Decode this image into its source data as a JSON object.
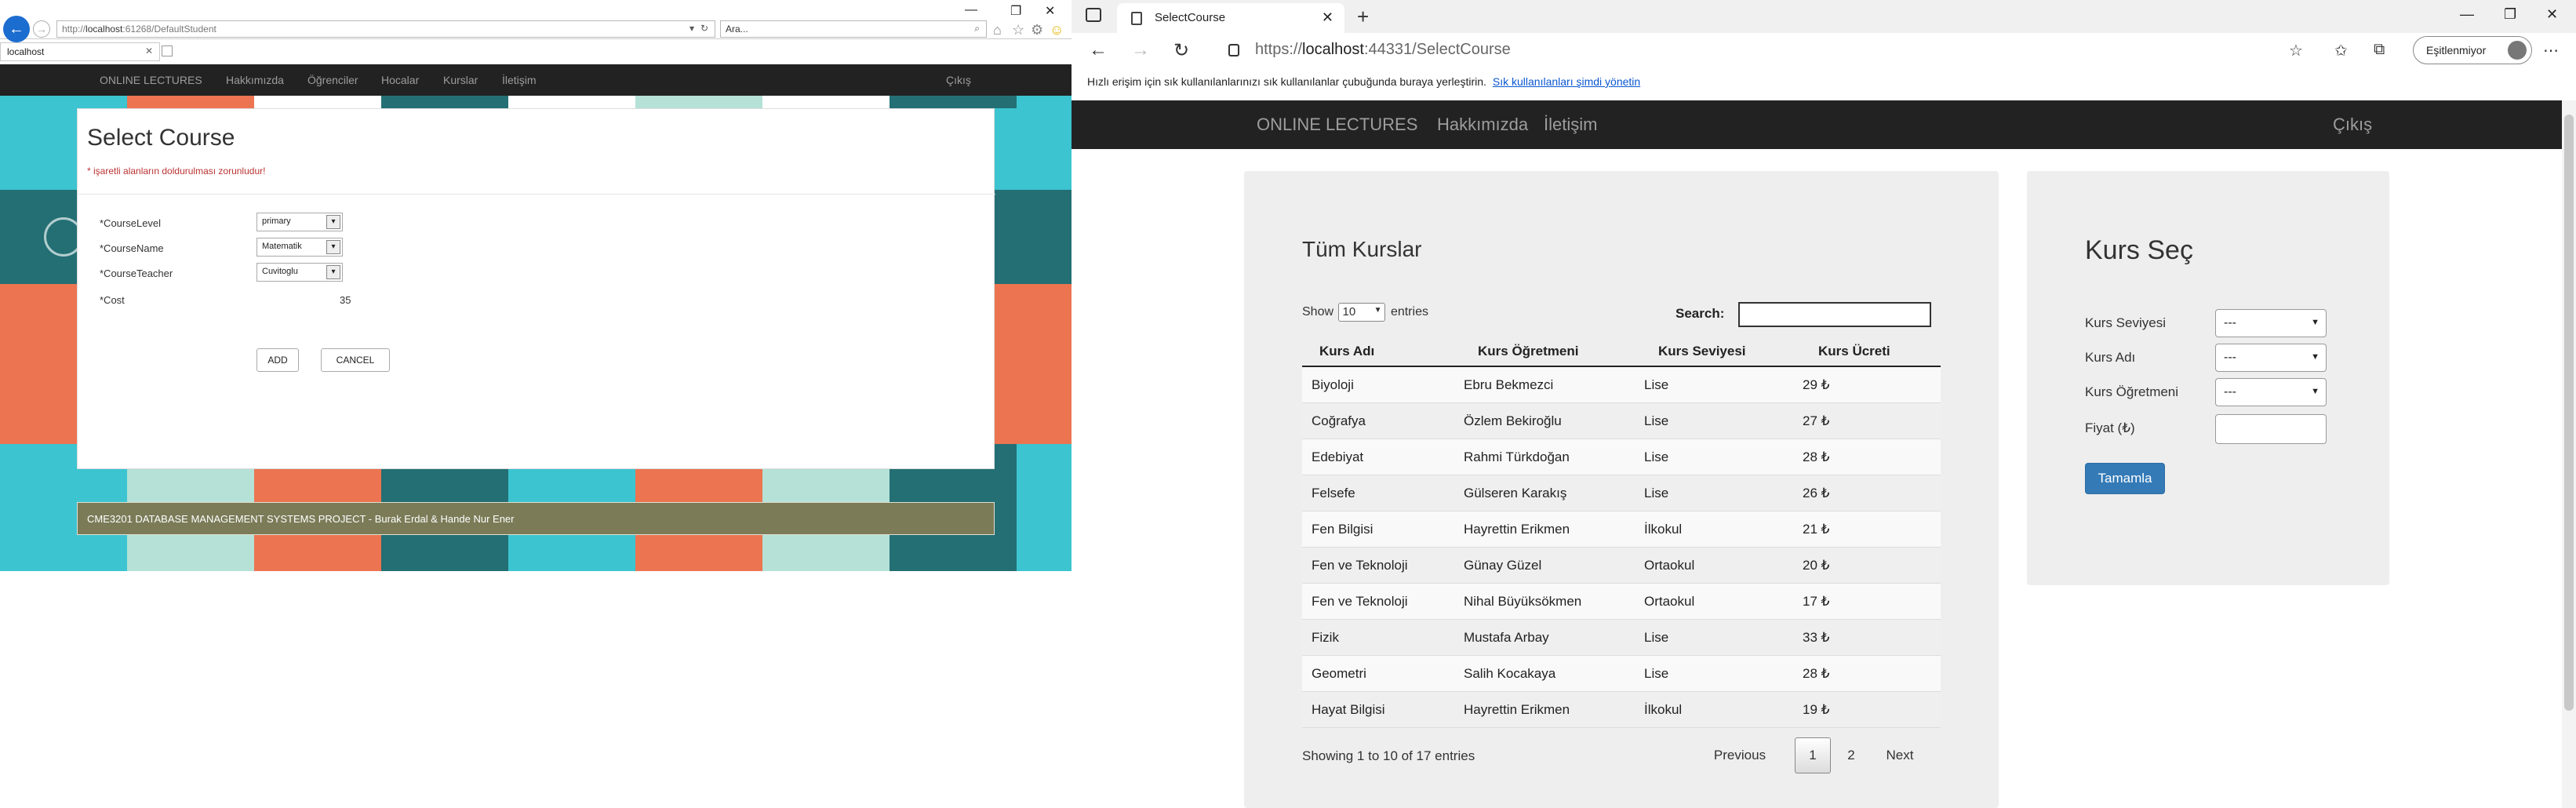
{
  "left_window": {
    "address": {
      "prefix": "http://",
      "host": "localhost",
      "rest": ":61268/DefaultStudent"
    },
    "search_placeholder": "Ara...",
    "tab_title": "localhost",
    "nav": {
      "items": [
        "ONLINE LECTURES",
        "Hakkımızda",
        "Öğrenciler",
        "Hocalar",
        "Kurslar",
        "İletişim"
      ],
      "logout": "Çıkış"
    },
    "form": {
      "title": "Select Course",
      "required_note": "* işaretli alanların doldurulması zorunludur!",
      "fields": [
        {
          "label": "*CourseLevel",
          "value": "primary"
        },
        {
          "label": "*CourseName",
          "value": "Matematik"
        },
        {
          "label": "*CourseTeacher",
          "value": "Cuvitoglu"
        }
      ],
      "cost_label": "*Cost",
      "cost_value": "35",
      "add_label": "ADD",
      "cancel_label": "CANCEL"
    },
    "footer": "CME3201 DATABASE MANAGEMENT SYSTEMS PROJECT - Burak Erdal & Hande Nur Ener"
  },
  "right_window": {
    "tab_title": "SelectCourse",
    "url": {
      "prefix": "https://",
      "host": "localhost",
      "rest": ":44331/SelectCourse"
    },
    "sync_label": "Eşitlenmiyor",
    "favorites_bar": {
      "text": "Hızlı erişim için sık kullanılanlarınızı sık kullanılanlar çubuğunda buraya yerleştirin.",
      "link": "Sık kullanılanları şimdi yönetin"
    },
    "nav": {
      "brand": "ONLINE LECTURES",
      "items": [
        "Hakkımızda",
        "İletişim"
      ],
      "logout": "Çıkış"
    },
    "all_courses": {
      "title": "Tüm Kurslar",
      "show": "Show",
      "entries_value": "10",
      "entries": "entries",
      "search_label": "Search:",
      "headers": [
        "Kurs Adı",
        "Kurs Öğretmeni",
        "Kurs Seviyesi",
        "Kurs Ücreti"
      ],
      "rows": [
        [
          "Biyoloji",
          "Ebru Bekmezci",
          "Lise",
          "29 ₺"
        ],
        [
          "Coğrafya",
          "Özlem Bekiroğlu",
          "Lise",
          "27 ₺"
        ],
        [
          "Edebiyat",
          "Rahmi Türkdoğan",
          "Lise",
          "28 ₺"
        ],
        [
          "Felsefe",
          "Gülseren Karakış",
          "Lise",
          "26 ₺"
        ],
        [
          "Fen Bilgisi",
          "Hayrettin Erikmen",
          "İlkokul",
          "21 ₺"
        ],
        [
          "Fen ve Teknoloji",
          "Günay Güzel",
          "Ortaokul",
          "20 ₺"
        ],
        [
          "Fen ve Teknoloji",
          "Nihal Büyüksökmen",
          "Ortaokul",
          "17 ₺"
        ],
        [
          "Fizik",
          "Mustafa Arbay",
          "Lise",
          "33 ₺"
        ],
        [
          "Geometri",
          "Salih Kocakaya",
          "Lise",
          "28 ₺"
        ],
        [
          "Hayat Bilgisi",
          "Hayrettin Erikmen",
          "İlkokul",
          "19 ₺"
        ]
      ],
      "info": "Showing 1 to 10 of 17 entries",
      "pagination": {
        "previous": "Previous",
        "page1": "1",
        "page2": "2",
        "next": "Next"
      }
    },
    "select_course": {
      "title": "Kurs Seç",
      "fields": [
        {
          "label": "Kurs Seviyesi",
          "value": "---"
        },
        {
          "label": "Kurs Adı",
          "value": "---"
        },
        {
          "label": "Kurs Öğretmeni",
          "value": "---"
        }
      ],
      "price_label": "Fiyat (₺)",
      "submit": "Tamamla"
    }
  },
  "colors": {
    "nav_bg": "#222222",
    "panel_bg": "#eeeeee",
    "primary_btn": "#337ab7",
    "footer_bar": "#7b7b58"
  }
}
